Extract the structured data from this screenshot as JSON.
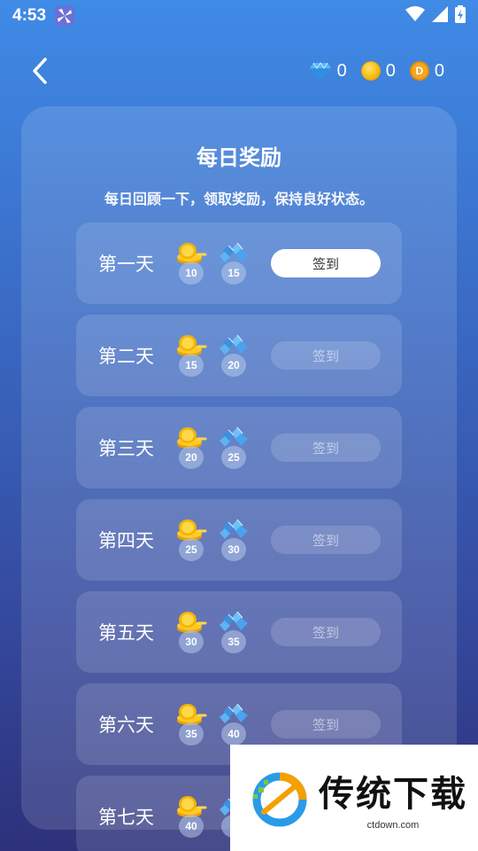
{
  "status": {
    "time": "4:53"
  },
  "header": {
    "back_icon": "chevron-left-icon",
    "currencies": [
      {
        "icon": "diamond-icon",
        "value": "0"
      },
      {
        "icon": "coin-icon",
        "value": "0"
      },
      {
        "icon": "d-coin-icon",
        "value": "0",
        "glyph": "D"
      }
    ]
  },
  "panel": {
    "title": "每日奖励",
    "subtitle": "每日回顾一下，领取奖励，保持良好状态。"
  },
  "days": [
    {
      "label": "第一天",
      "coins": "10",
      "gems": "15",
      "button": "签到",
      "active": true
    },
    {
      "label": "第二天",
      "coins": "15",
      "gems": "20",
      "button": "签到",
      "active": false
    },
    {
      "label": "第三天",
      "coins": "20",
      "gems": "25",
      "button": "签到",
      "active": false
    },
    {
      "label": "第四天",
      "coins": "25",
      "gems": "30",
      "button": "签到",
      "active": false
    },
    {
      "label": "第五天",
      "coins": "30",
      "gems": "35",
      "button": "签到",
      "active": false
    },
    {
      "label": "第六天",
      "coins": "35",
      "gems": "40",
      "button": "签到",
      "active": false
    },
    {
      "label": "第七天",
      "coins": "40",
      "gems": "",
      "button": "",
      "active": false
    }
  ],
  "watermark": {
    "title": "传统下载",
    "url": "ctdown.com"
  },
  "colors": {
    "bg_top": "#3f8be6",
    "bg_bottom": "#2d317a",
    "coin": "#f4b400",
    "gem": "#4aa3f0"
  }
}
